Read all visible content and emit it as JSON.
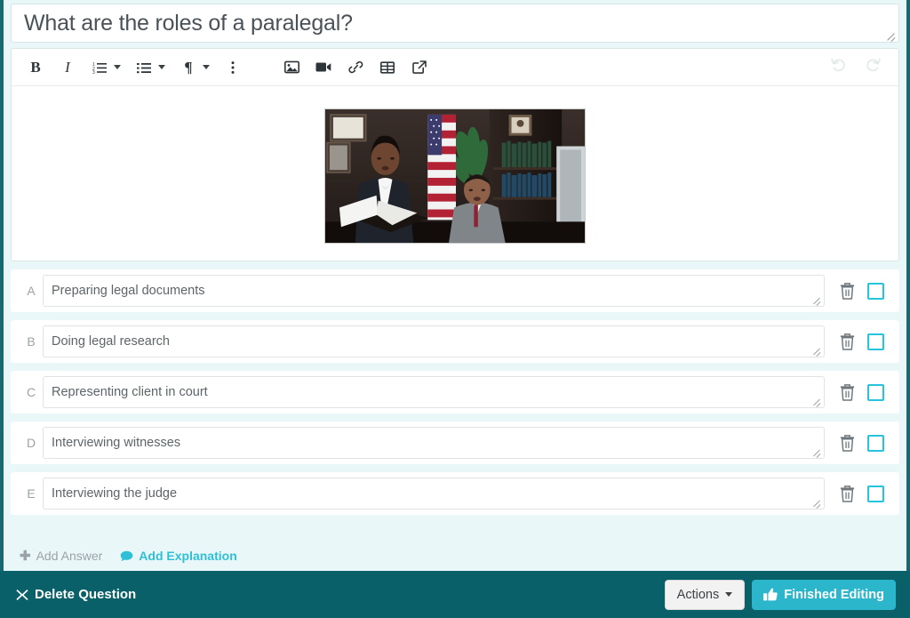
{
  "question": {
    "title": "What are the roles of a paralegal?",
    "image_alt": "Paralegal standing with documents beside seated attorney in a law office with American flag and bookshelves"
  },
  "toolbar": {
    "bold": "B",
    "italic": "I",
    "ordered_list": "ordered-list-icon",
    "unordered_list": "unordered-list-icon",
    "paragraph": "¶",
    "more_options": "more-options-icon",
    "insert_image": "image-icon",
    "insert_video": "video-icon",
    "insert_link": "link-icon",
    "insert_table": "table-icon",
    "insert_embed": "embed-icon",
    "undo": "undo-icon",
    "redo": "redo-icon"
  },
  "answers": [
    {
      "letter": "A",
      "text": "Preparing legal documents",
      "checked": false
    },
    {
      "letter": "B",
      "text": "Doing legal research",
      "checked": false
    },
    {
      "letter": "C",
      "text": "Representing client in court",
      "checked": false
    },
    {
      "letter": "D",
      "text": "Interviewing witnesses",
      "checked": false
    },
    {
      "letter": "E",
      "text": "Interviewing the judge",
      "checked": false
    }
  ],
  "actions_bar": {
    "add_answer": "Add Answer",
    "add_answer_icon": "plus-icon",
    "add_explanation": "Add Explanation",
    "add_explanation_icon": "comment-icon"
  },
  "footer": {
    "delete_question": "Delete Question",
    "delete_icon": "close-x-icon",
    "actions": "Actions",
    "finished_editing": "Finished Editing",
    "thumbs_up_icon": "thumbs-up-icon"
  },
  "colors": {
    "page_bg": "#eaf7f8",
    "frame_border": "#17696f",
    "footer_bg": "#0a6068",
    "accent_cyan": "#2bb6cc",
    "checkbox_cyan": "#28c3dc",
    "muted_text": "#9aa3a7"
  }
}
